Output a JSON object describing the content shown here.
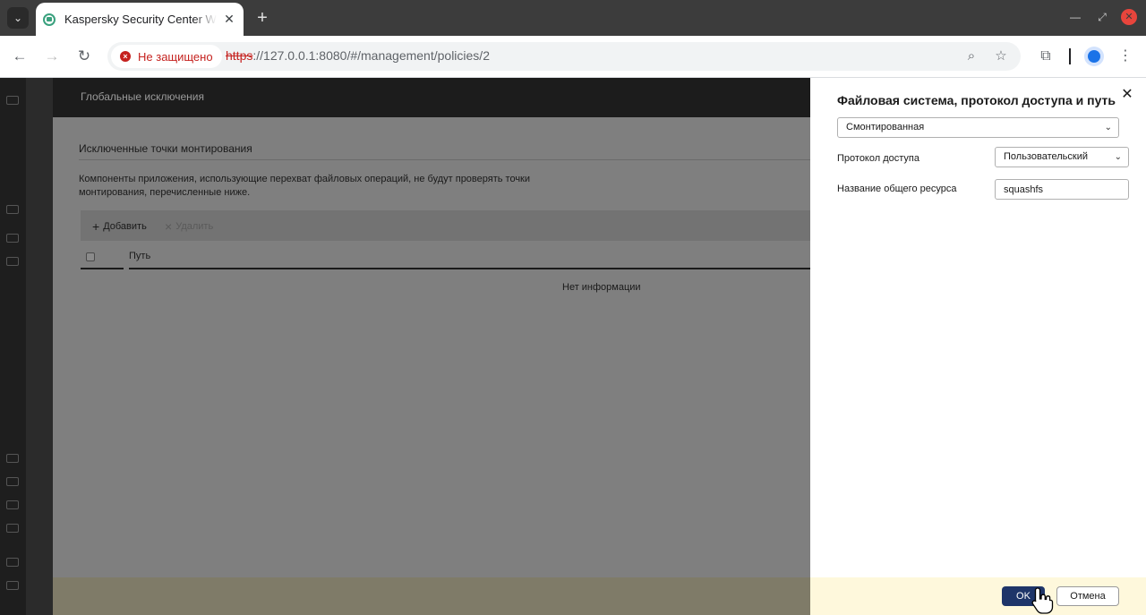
{
  "browser": {
    "tab_title": "Kaspersky Security Center Web Console",
    "tab_close": "✕",
    "new_tab": "+",
    "security_label": "Не защищено",
    "url_scheme": "https",
    "url_rest": "://127.0.0.1:8080/#/management/policies/2"
  },
  "app": {
    "header_title": "Глобальные исключения",
    "section_title": "Исключенные точки монтирования",
    "section_desc": "Компоненты приложения, использующие перехват файловых операций, не будут проверять точки монтирования, перечисленные ниже.",
    "add_label": "Добавить",
    "delete_label": "Удалить",
    "col_path": "Путь",
    "no_info": "Нет информации"
  },
  "drawer": {
    "title": "Файловая система, протокол доступа и путь",
    "fs_type_value": "Смонтированная",
    "protocol_label": "Протокол доступа",
    "protocol_value": "Пользовательский",
    "share_label": "Название общего ресурса",
    "share_value": "squashfs",
    "ok_label": "OK",
    "cancel_label": "Отмена"
  },
  "colors": {
    "ok_button": "#1e3569",
    "footer": "#fef8dc",
    "insecure": "#c5221f"
  },
  "icons": [
    "chevron-down-icon",
    "browser-app-icon",
    "close-icon",
    "plus-icon",
    "minimize-icon",
    "restore-icon",
    "back-icon",
    "forward-icon",
    "reload-icon",
    "warning-icon",
    "zoom-icon",
    "star-icon",
    "extensions-icon",
    "profile-icon",
    "menu-icon",
    "hand-cursor-icon"
  ]
}
